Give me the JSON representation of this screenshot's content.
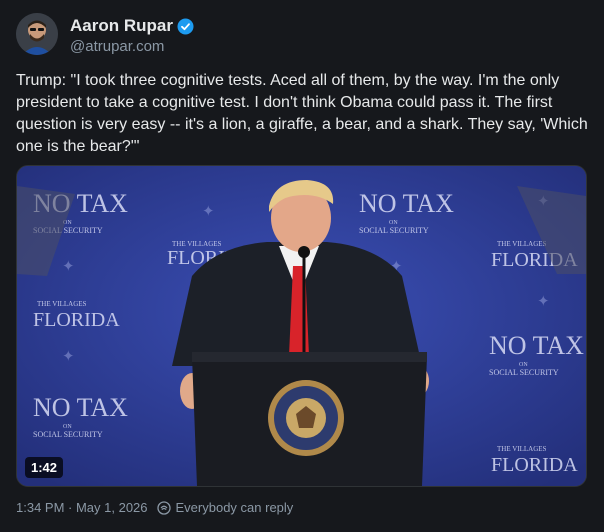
{
  "author": {
    "display_name": "Aaron Rupar",
    "handle": "@atrupar.com",
    "verified": true
  },
  "post": {
    "text": "Trump: \"I took three cognitive tests. Aced all of them, by the way. I'm the only president to take a cognitive test. I don't think Obama could pass it. The first question is very easy -- it's a lion, a giraffe, a bear, and a shark. They say, 'Which one is the bear?'\""
  },
  "media": {
    "duration": "1:42",
    "backdrop_text": {
      "no_tax": "NO TAX",
      "on": "ON",
      "social_security": "SOCIAL SECURITY",
      "the_villages": "THE VILLAGES",
      "florida": "FLORIDA"
    },
    "seal_text": "SEAL OF THE PRESIDENT OF THE UNITED STATES"
  },
  "meta": {
    "timestamp": "1:34 PM · May 1, 2026",
    "reply_setting": "Everybody can reply"
  },
  "colors": {
    "background": "#16181c",
    "verified_blue": "#1d9bf0",
    "backdrop_blue": "#2c3a8c"
  }
}
